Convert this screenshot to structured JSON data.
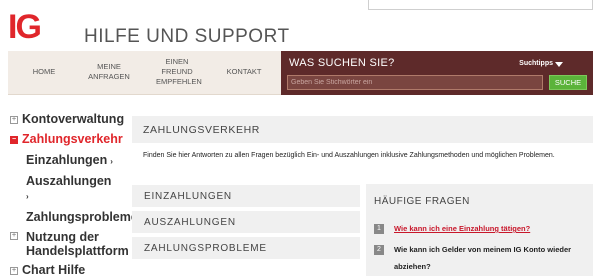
{
  "brand": {
    "logo_text": "IG",
    "title": "HILFE UND SUPPORT",
    "accent": "#e0262b"
  },
  "nav": {
    "home": "HOME",
    "requests": "MEINE\nANFRAGEN",
    "refer": "EINEN\nFREUND\nEMPFEHLEN",
    "contact": "KONTAKT"
  },
  "search": {
    "title": "WAS SUCHEN SIE?",
    "tips": "Suchtipps",
    "placeholder": "Geben Sie Stichwörter ein",
    "button": "SUCHE",
    "bg": "#5e2a2a",
    "button_color": "#5bb33a"
  },
  "sidebar": {
    "items": [
      {
        "label": "Kontoverwaltung",
        "sign": "+"
      },
      {
        "label": "Zahlungsverkehr",
        "sign": "−"
      },
      {
        "label": "Einzahlungen"
      },
      {
        "label": "Auszahlungen"
      },
      {
        "label": "Zahlungsprobleme"
      },
      {
        "label": "Nutzung der Handelsplattform",
        "sign": "+"
      },
      {
        "label": "Chart Hilfe",
        "sign": "+"
      }
    ]
  },
  "main": {
    "section_title": "ZAHLUNGSVERKEHR",
    "intro": "Finden Sie hier Antworten zu allen Fragen bezüglich Ein- und Auszahlungen inklusive Zahlungsmethoden und möglichen Problemen.",
    "tabs": [
      {
        "label": "EINZAHLUNGEN"
      },
      {
        "label": "AUSZAHLUNGEN"
      },
      {
        "label": "ZAHLUNGSPROBLEME"
      }
    ]
  },
  "faq": {
    "title": "HÄUFIGE FRAGEN",
    "items": [
      {
        "num": "1",
        "q": "Wie kann ich eine Einzahlung tätigen?"
      },
      {
        "num": "2",
        "q": "Wie kann ich Gelder von meinem IG Konto wieder abziehen?"
      }
    ]
  }
}
